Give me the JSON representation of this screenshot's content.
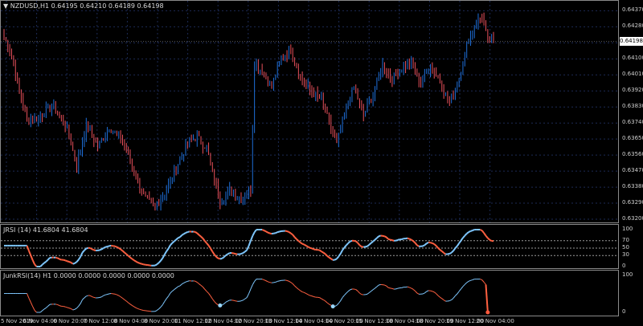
{
  "main": {
    "header": {
      "symbol": "NZDUSD,H1",
      "ohlc": "0.64195 0.64210 0.64189 0.64198"
    },
    "current_price": "0.64198",
    "price_ticks": [
      "0.64370",
      "0.64280",
      "0.64190",
      "0.64100",
      "0.64010",
      "0.63920",
      "0.63830",
      "0.63740",
      "0.63650",
      "0.63560",
      "0.63470",
      "0.63380",
      "0.63290",
      "0.63200"
    ]
  },
  "jrsi": {
    "label": "JRSI (14) 41.6804 41.6804",
    "ticks": [
      "100",
      "70",
      "50",
      "30",
      "0"
    ],
    "levels": [
      70,
      50,
      30
    ]
  },
  "junk": {
    "label": "JunkRSI(14) H1 0.0000 0.0000 0.0000 0.0000 0.0000",
    "ticks": [
      "100",
      "0"
    ]
  },
  "time_axis": [
    "5 Nov 2019",
    "6 Nov 04:00",
    "6 Nov 20:00",
    "7 Nov 12:00",
    "8 Nov 04:00",
    "8 Nov 20:00",
    "11 Nov 12:00",
    "12 Nov 04:00",
    "12 Nov 20:00",
    "13 Nov 12:00",
    "14 Nov 04:00",
    "14 Nov 20:00",
    "15 Nov 12:00",
    "18 Nov 04:00",
    "18 Nov 20:00",
    "19 Nov 12:00",
    "20 Nov 04:00"
  ],
  "colors": {
    "background": "#000000",
    "grid": "#1c2a55",
    "bull": "#1e6fd9",
    "bear": "#e8505b",
    "rsi_up": "#7fc8ff",
    "rsi_down": "#ff6040",
    "dot_high": "#ff5a3c",
    "dot_low": "#9ad8ff"
  },
  "chart_data": {
    "type": "candlestick",
    "title": "NZDUSD,H1",
    "ylim": [
      0.632,
      0.6439
    ],
    "close_anchors": [
      [
        0,
        0.6422
      ],
      [
        3,
        0.6416
      ],
      [
        8,
        0.6392
      ],
      [
        12,
        0.6376
      ],
      [
        18,
        0.6377
      ],
      [
        25,
        0.6384
      ],
      [
        33,
        0.6371
      ],
      [
        38,
        0.635
      ],
      [
        43,
        0.6373
      ],
      [
        49,
        0.6361
      ],
      [
        55,
        0.6372
      ],
      [
        62,
        0.6364
      ],
      [
        68,
        0.6347
      ],
      [
        73,
        0.6333
      ],
      [
        79,
        0.6327
      ],
      [
        84,
        0.6334
      ],
      [
        90,
        0.6349
      ],
      [
        96,
        0.6363
      ],
      [
        101,
        0.6366
      ],
      [
        106,
        0.636
      ],
      [
        110,
        0.6342
      ],
      [
        113,
        0.633
      ],
      [
        118,
        0.6336
      ],
      [
        124,
        0.6331
      ],
      [
        129,
        0.6337
      ],
      [
        131,
        0.6408
      ],
      [
        135,
        0.6403
      ],
      [
        140,
        0.6394
      ],
      [
        145,
        0.6411
      ],
      [
        150,
        0.6415
      ],
      [
        155,
        0.64
      ],
      [
        161,
        0.6391
      ],
      [
        166,
        0.6387
      ],
      [
        171,
        0.6371
      ],
      [
        174,
        0.6362
      ],
      [
        178,
        0.6379
      ],
      [
        183,
        0.6394
      ],
      [
        188,
        0.6378
      ],
      [
        193,
        0.639
      ],
      [
        198,
        0.6407
      ],
      [
        203,
        0.6399
      ],
      [
        208,
        0.6405
      ],
      [
        213,
        0.6407
      ],
      [
        218,
        0.6396
      ],
      [
        223,
        0.6407
      ],
      [
        228,
        0.6397
      ],
      [
        233,
        0.6385
      ],
      [
        238,
        0.6399
      ],
      [
        243,
        0.6422
      ],
      [
        248,
        0.6432
      ],
      [
        250,
        0.6434
      ],
      [
        253,
        0.642
      ],
      [
        256,
        0.6422
      ]
    ]
  }
}
